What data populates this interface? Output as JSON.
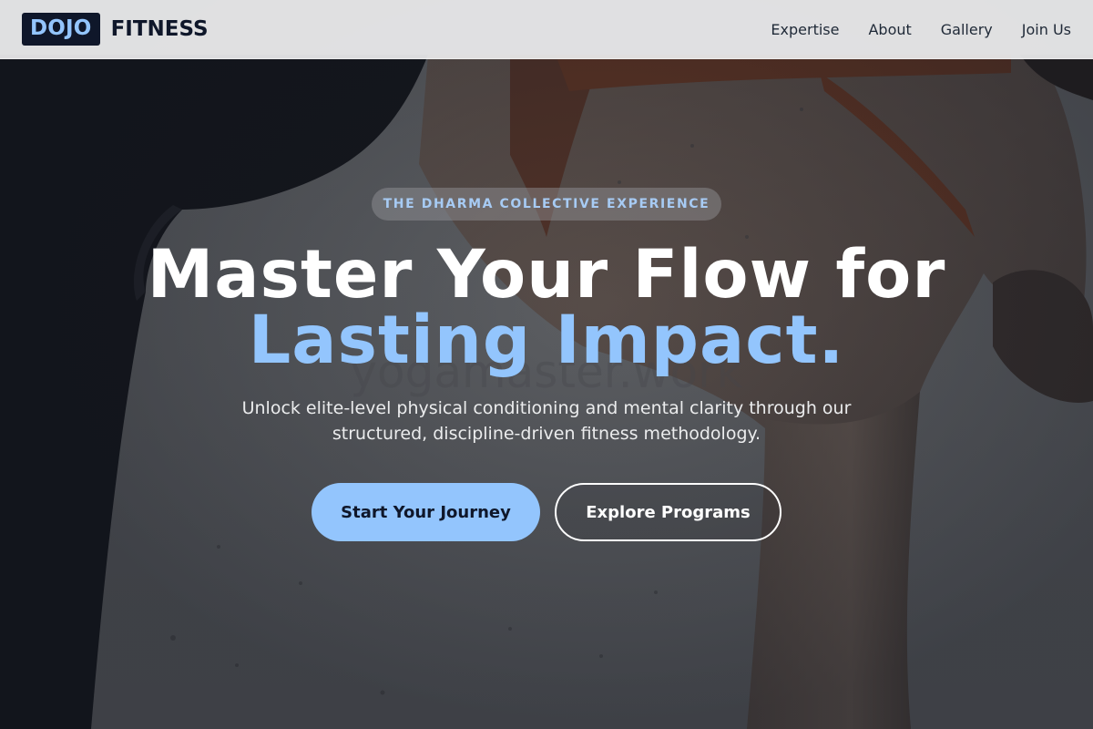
{
  "brand": {
    "box_text": "DOJO",
    "text": "FITNESS"
  },
  "nav": {
    "links": [
      {
        "label": "Expertise"
      },
      {
        "label": "About"
      },
      {
        "label": "Gallery"
      },
      {
        "label": "Join Us"
      }
    ]
  },
  "hero": {
    "eyebrow": "THE DHARMA COLLECTIVE EXPERIENCE",
    "title_line1": "Master Your Flow for",
    "title_line2": "Lasting Impact.",
    "watermark": "yogamaster.work",
    "subtitle": "Unlock elite-level physical conditioning and mental clarity through our structured, discipline-driven fitness methodology.",
    "primary_cta": "Start Your Journey",
    "secondary_cta": "Explore Programs"
  },
  "colors": {
    "accent": "#93c5fd",
    "brand_dark": "#0f172a",
    "nav_bg": "#ececed"
  }
}
